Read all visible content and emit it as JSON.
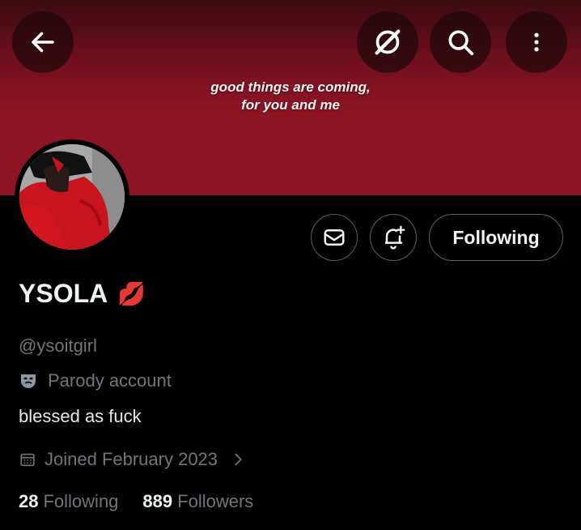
{
  "banner": {
    "line1": "good things are coming,",
    "line2": "for you and me",
    "color": "#8c1423"
  },
  "top_bar": {
    "back_icon": "arrow-left-icon",
    "grok_icon": "grok-icon",
    "search_icon": "search-icon",
    "more_icon": "more-vertical-icon"
  },
  "actions": {
    "message_icon": "envelope-icon",
    "notify_icon": "bell-plus-icon",
    "follow_label": "Following"
  },
  "profile": {
    "display_name": "YSOLA",
    "name_emoji": "💋",
    "handle": "@ysoitgirl",
    "parody_label": "Parody account",
    "bio": "blessed as fuck",
    "joined": "Joined February 2023",
    "following_count": "28",
    "following_label": "Following",
    "followers_count": "889",
    "followers_label": "Followers"
  }
}
